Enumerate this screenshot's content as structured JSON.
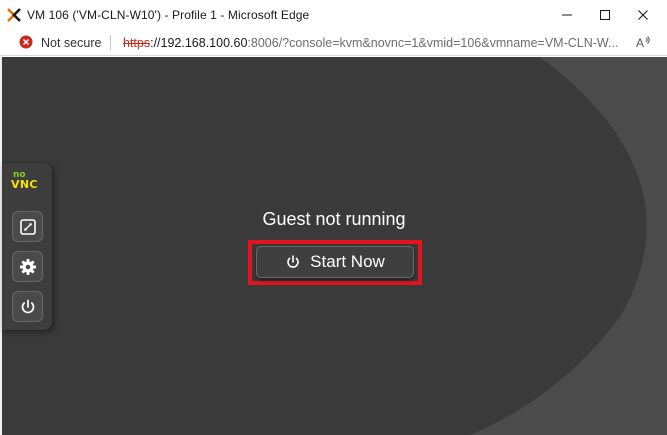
{
  "window": {
    "title": "VM 106 ('VM-CLN-W10') - Profile 1 - Microsoft Edge"
  },
  "addressbar": {
    "security_label": "Not secure",
    "url_protocol": "https",
    "url_host": "://192.168.100.60",
    "url_rest": ":8006/?console=kvm&novnc=1&vmid=106&vmname=VM-CLN-W..."
  },
  "novnc": {
    "logo_no": "no",
    "logo_vnc": "VNC"
  },
  "guest": {
    "status_text": "Guest not running",
    "start_button_label": "Start Now"
  },
  "colors": {
    "highlight": "#e3141f",
    "viewport_bg": "#3a3a3a",
    "logo_green": "#7cd319",
    "logo_yellow": "#f7e200"
  }
}
